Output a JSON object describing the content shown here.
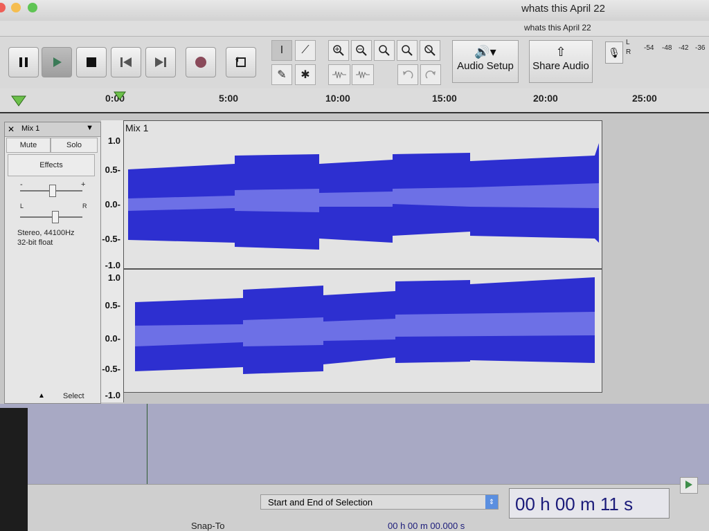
{
  "window": {
    "title": "whats this April 22",
    "subtitle": "whats this April 22"
  },
  "transport": {
    "pause_icon": "pause-icon",
    "play_icon": "play-icon",
    "stop_icon": "stop-icon",
    "skip_start_icon": "skip-to-start-icon",
    "skip_end_icon": "skip-to-end-icon",
    "record_icon": "record-icon",
    "loop_icon": "loop-icon"
  },
  "tools": {
    "select": "I",
    "envelope": "⟋",
    "draw": "✎",
    "multi": "✱"
  },
  "buttons": {
    "audio_setup": "Audio Setup",
    "share_audio": "Share Audio"
  },
  "meter": {
    "labels": [
      "-54",
      "-48",
      "-42",
      "-36"
    ],
    "l": "L",
    "r": "R"
  },
  "ruler": {
    "ticks": [
      "0:00",
      "5:00",
      "10:00",
      "15:00",
      "20:00",
      "25:00"
    ]
  },
  "track": {
    "name": "Mix 1",
    "clip_name": "Mix 1",
    "mute": "Mute",
    "solo": "Solo",
    "effects": "Effects",
    "gain_minus": "-",
    "gain_plus": "+",
    "pan_l": "L",
    "pan_r": "R",
    "info_line1": "Stereo, 44100Hz",
    "info_line2": "32-bit float",
    "select": "Select",
    "scale_top": [
      "1.0",
      "0.5-",
      "0.0-",
      "-0.5-",
      "-1.0"
    ],
    "scale_bottom": [
      "1.0",
      "0.5-",
      "0.0-",
      "-0.5-",
      "-1.0"
    ]
  },
  "bottom": {
    "snap_to": "Snap-To",
    "selection_mode": "Start and End of Selection",
    "selection_value": "00 h 00 m 00.000 s",
    "time": "00 h 00 m 11 s"
  },
  "colors": {
    "wave": "#2d2fd0",
    "wave_light": "#6d70e6",
    "accent_green": "#5fae3f"
  }
}
